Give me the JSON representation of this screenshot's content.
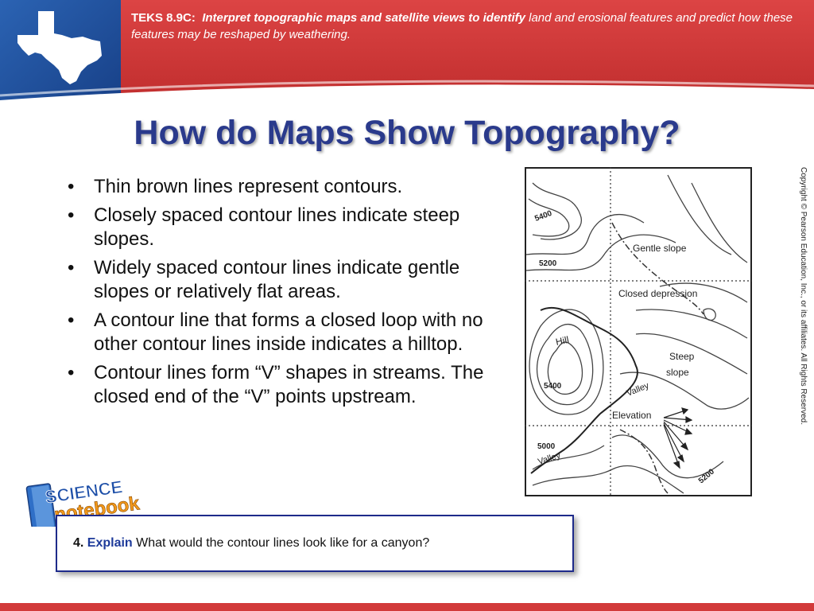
{
  "header": {
    "teks_label": "TEKS 8.9C:",
    "teks_emphasis": "Interpret topographic maps and satellite views to identify",
    "teks_rest": "land and erosional features and predict how these features may be reshaped by weathering."
  },
  "title": "How do Maps Show Topography?",
  "bullets": [
    "Thin brown lines represent contours.",
    "Closely spaced contour lines indicate steep slopes.",
    "Widely spaced contour lines indicate gentle slopes or relatively flat areas.",
    "A contour line that forms a closed loop with no other contour lines inside indicates a hilltop.",
    "Contour lines form “V” shapes in streams. The closed end of the “V” points upstream."
  ],
  "map": {
    "labels": {
      "elev_5400_top": "5400",
      "elev_5200_left": "5200",
      "gentle_slope": "Gentle slope",
      "closed_depression": "Closed depression",
      "hill": "Hill",
      "steep": "Steep",
      "slope": "slope",
      "elev_5400_hill": "5400",
      "valley_mid": "Valley",
      "elevation": "Elevation",
      "elev_5000": "5000",
      "valley_low": "Valley",
      "elev_5200_bottom": "5200"
    }
  },
  "copyright": "Copyright © Pearson Education, Inc., or its affiliates. All Rights Reserved.",
  "notebook": {
    "line1": "SCIENCE",
    "line2": "notebook"
  },
  "question": {
    "number": "4.",
    "keyword": "Explain",
    "text": "What would the contour lines look like for a canyon?"
  },
  "colors": {
    "header_red": "#d23a3a",
    "header_blue": "#1f4f9c",
    "title_blue": "#2a3a8c"
  }
}
